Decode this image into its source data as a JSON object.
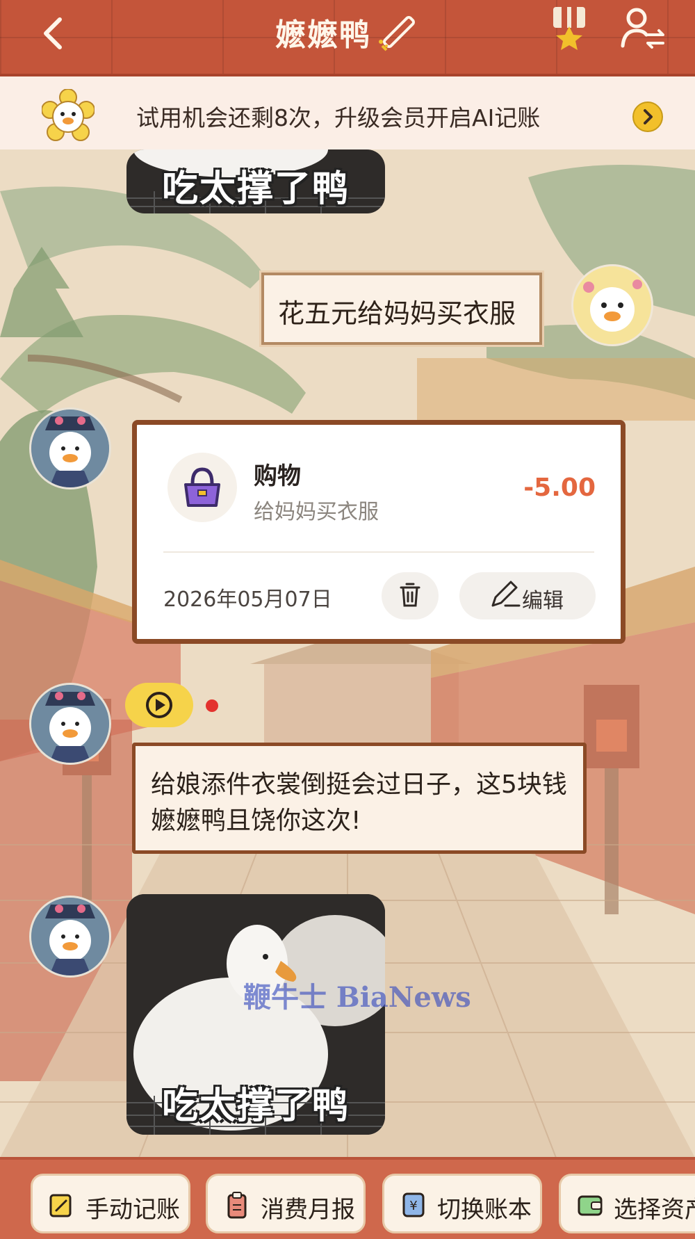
{
  "header": {
    "title": "嬷嬷鸭"
  },
  "banner": {
    "text": "试用机会还剩8次，升级会员开启AI记账"
  },
  "chat": {
    "meme_caption": "吃太撑了鸭",
    "user_message": "花五元给妈妈买衣服",
    "transaction": {
      "category": "购物",
      "note": "给妈妈买衣服",
      "amount": "-5.00",
      "date": "2026年05月07日",
      "edit_label": "编辑"
    },
    "reply": "给娘添件衣裳倒挺会过日子，这5块钱嬷嬷鸭且饶你这次!",
    "meme2_caption": "吃太撑了鸭"
  },
  "watermark": "鞭牛士 BiaNews",
  "bottom_bar": {
    "actions": [
      "手动记账",
      "消费月报",
      "切换账本",
      "选择资产"
    ]
  },
  "colors": {
    "header_bg": "#c4553a",
    "card_border": "#8b4a26",
    "amount": "#e4673f",
    "bottom_bar": "#cf684c",
    "voice": "#f6d34a"
  }
}
